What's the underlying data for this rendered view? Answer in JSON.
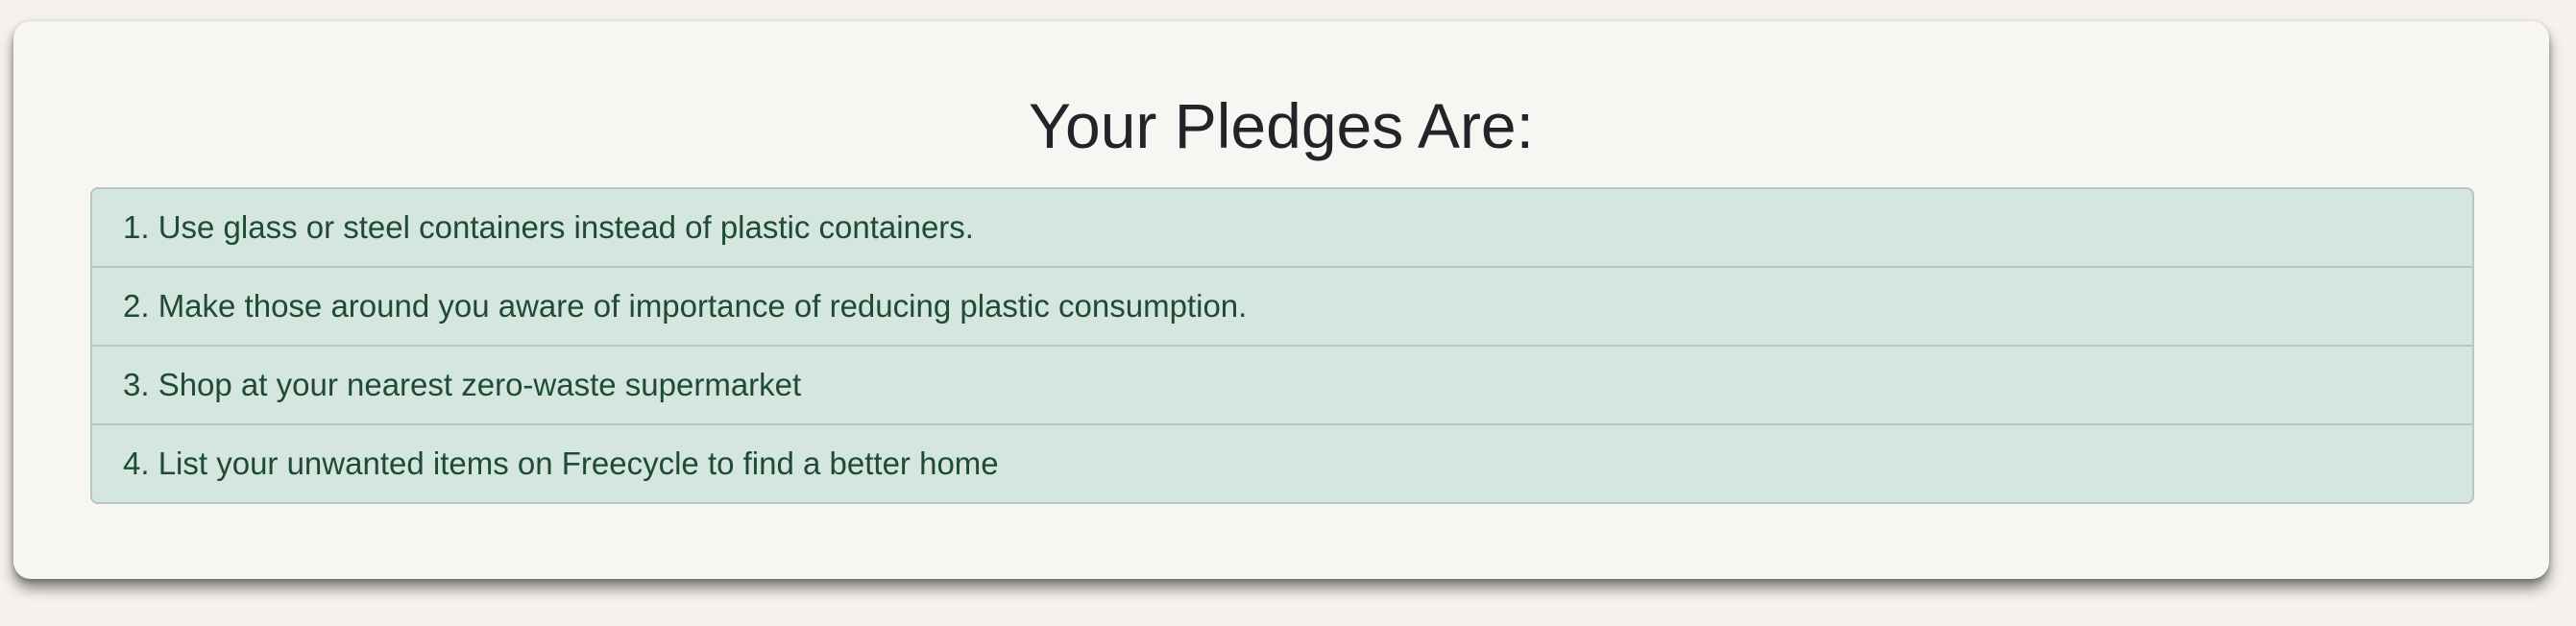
{
  "page": {
    "title": "Your Pledges Are:"
  },
  "pledges": [
    {
      "text": "1. Use glass or steel containers instead of plastic containers."
    },
    {
      "text": "2. Make those around you aware of importance of reducing plastic consumption."
    },
    {
      "text": "3. Shop at your nearest zero-waste supermarket"
    },
    {
      "text": "4. List your unwanted items on Freecycle to find a better home"
    }
  ],
  "colors": {
    "page_background": "#f5f2ee",
    "card_background": "#f8f6f2",
    "list_background": "#d4e6df",
    "list_border": "#b3cabd",
    "list_text": "#1f4b33",
    "title_text": "#212529"
  }
}
